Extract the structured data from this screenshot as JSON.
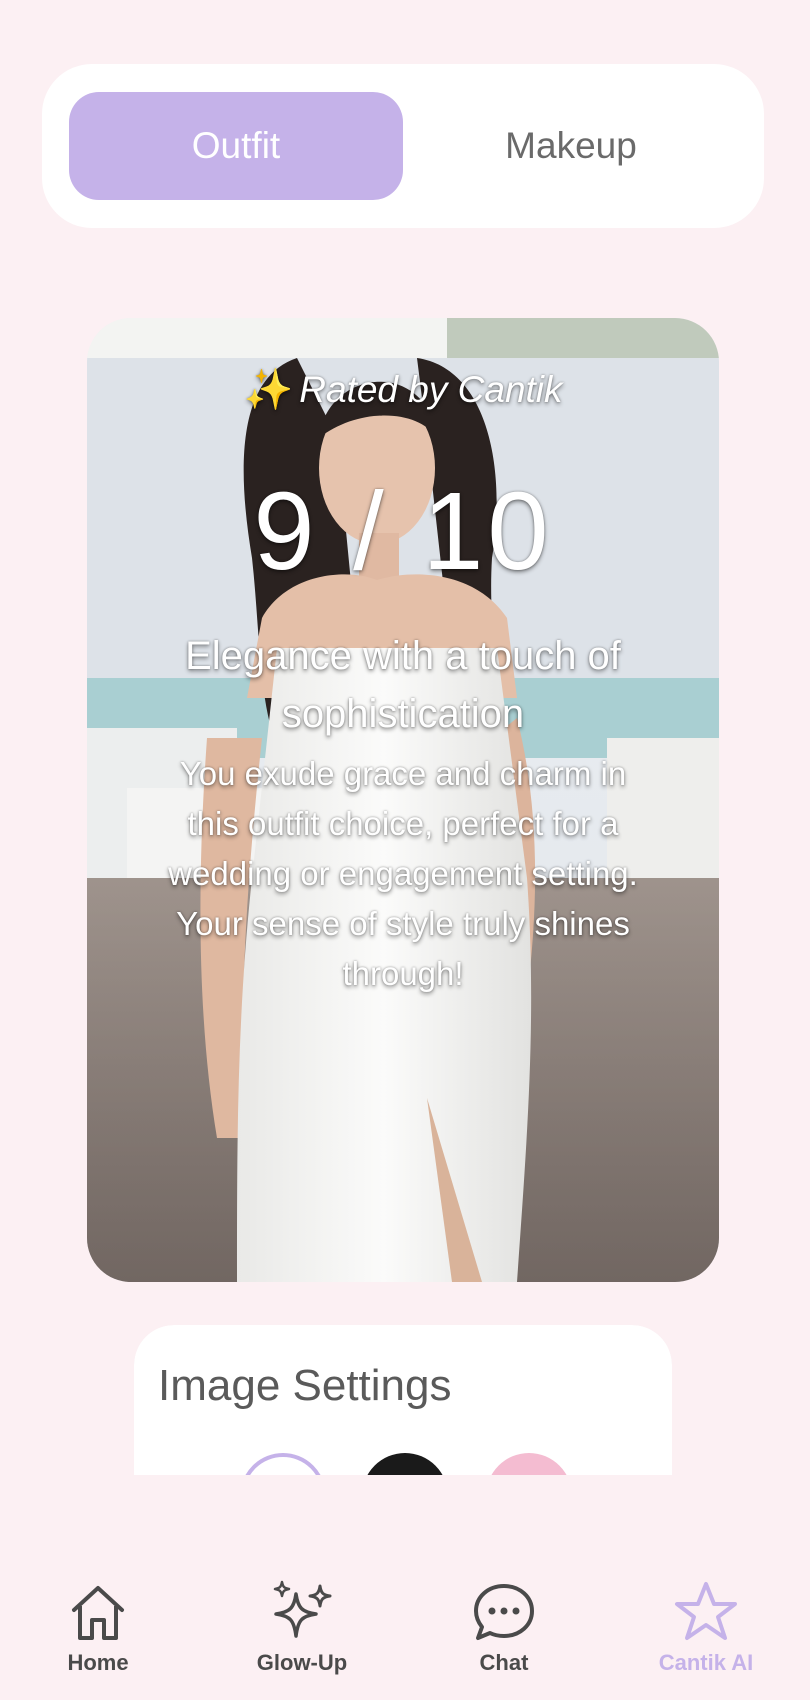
{
  "tabs": {
    "active_label": "Outfit",
    "inactive_label": "Makeup"
  },
  "card": {
    "rated_by": "Rated by Cantik",
    "sparkle": "✨",
    "score": "9 / 10",
    "headline": "Elegance with a touch of sophistication",
    "description": "You exude grace and charm in this outfit choice, perfect for a wedding or engagement setting. Your sense of style truly shines through!"
  },
  "settings": {
    "title": "Image Settings",
    "swatches": [
      "#ffffff",
      "#1a1a1a",
      "#f4bcd1"
    ]
  },
  "nav": {
    "home": "Home",
    "glow_up": "Glow-Up",
    "chat": "Chat",
    "cantik_ai": "Cantik AI"
  },
  "colors": {
    "accent": "#c5b2e9",
    "background": "#fcf0f3",
    "nav_text": "#4a4a4a"
  }
}
